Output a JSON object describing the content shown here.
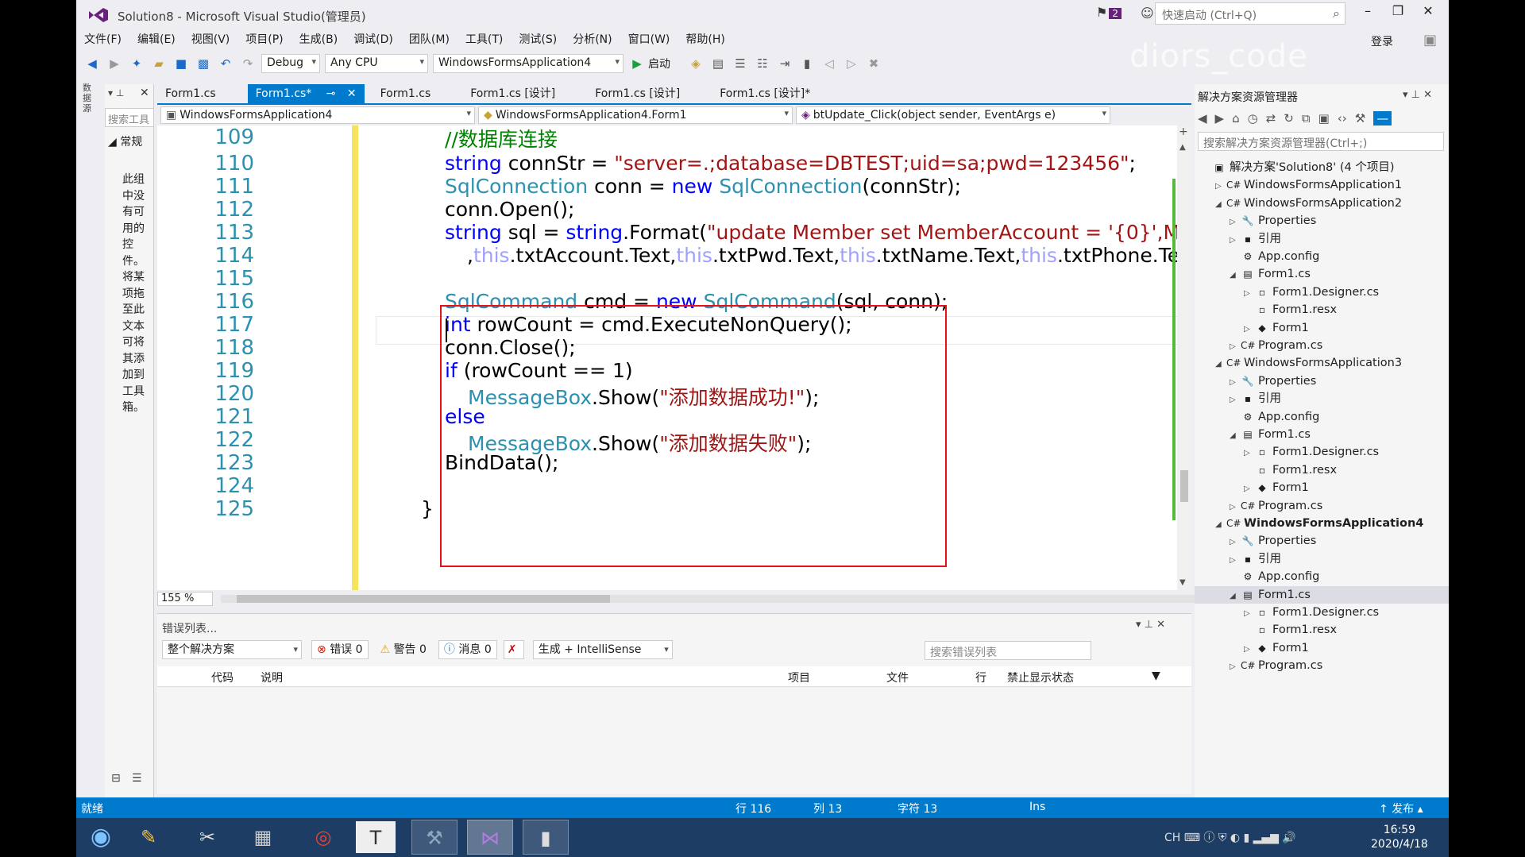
{
  "window": {
    "title": "Solution8 - Microsoft Visual Studio(管理员)",
    "notif_count": "2",
    "quick_launch_placeholder": "快速启动 (Ctrl+Q)",
    "login": "登录",
    "watermark": "diors_code"
  },
  "menu": [
    "文件(F)",
    "编辑(E)",
    "视图(V)",
    "项目(P)",
    "生成(B)",
    "调试(D)",
    "团队(M)",
    "工具(T)",
    "测试(S)",
    "分析(N)",
    "窗口(W)",
    "帮助(H)"
  ],
  "toolbar": {
    "config": "Debug",
    "platform": "Any CPU",
    "startup": "WindowsFormsApplication4",
    "start": "启动"
  },
  "toolbox": {
    "search": "搜索工具",
    "group": "常规",
    "hint": "此组中没有可用的控件。将某项拖至此文本可将其添加到工具箱。"
  },
  "tabs": [
    {
      "label": "Form1.cs",
      "active": false
    },
    {
      "label": "Form1.cs*",
      "active": true
    },
    {
      "label": "Form1.cs",
      "active": false
    },
    {
      "label": "Form1.cs [设计]",
      "active": false
    },
    {
      "label": "Form1.cs [设计]",
      "active": false
    },
    {
      "label": "Form1.cs [设计]*",
      "active": false
    }
  ],
  "nav": {
    "project": "WindowsFormsApplication4",
    "class": "WindowsFormsApplication4.Form1",
    "member": "btUpdate_Click(object sender, EventArgs e)"
  },
  "editor": {
    "zoom": "155 %",
    "line_numbers": [
      "109",
      "110",
      "111",
      "112",
      "113",
      "114",
      "115",
      "116",
      "117",
      "118",
      "119",
      "120",
      "121",
      "122",
      "123",
      "124",
      "125"
    ]
  },
  "error_list": {
    "title": "错误列表...",
    "scope": "整个解决方案",
    "errors": "错误 0",
    "warnings": "警告 0",
    "messages": "消息 0",
    "source": "生成 + IntelliSense",
    "search": "搜索错误列表",
    "columns": [
      "代码",
      "说明",
      "项目",
      "文件",
      "行",
      "禁止显示状态"
    ]
  },
  "solution_explorer": {
    "title": "解决方案资源管理器",
    "search": "搜索解决方案资源管理器(Ctrl+;)",
    "items": [
      {
        "label": "解决方案'Solution8' (4 个项目)",
        "level": 0,
        "exp": "",
        "icon": "▣"
      },
      {
        "label": "WindowsFormsApplication1",
        "level": 1,
        "exp": "▷",
        "icon": "C#"
      },
      {
        "label": "WindowsFormsApplication2",
        "level": 1,
        "exp": "◢",
        "icon": "C#"
      },
      {
        "label": "Properties",
        "level": 2,
        "exp": "▷",
        "icon": "🔧"
      },
      {
        "label": "引用",
        "level": 2,
        "exp": "▷",
        "icon": "▪"
      },
      {
        "label": "App.config",
        "level": 2,
        "exp": "",
        "icon": "⚙"
      },
      {
        "label": "Form1.cs",
        "level": 2,
        "exp": "◢",
        "icon": "▤"
      },
      {
        "label": "Form1.Designer.cs",
        "level": 3,
        "exp": "▷",
        "icon": "▫"
      },
      {
        "label": "Form1.resx",
        "level": 3,
        "exp": "",
        "icon": "▫"
      },
      {
        "label": "Form1",
        "level": 3,
        "exp": "▷",
        "icon": "◆"
      },
      {
        "label": "Program.cs",
        "level": 2,
        "exp": "▷",
        "icon": "C#"
      },
      {
        "label": "WindowsFormsApplication3",
        "level": 1,
        "exp": "◢",
        "icon": "C#"
      },
      {
        "label": "Properties",
        "level": 2,
        "exp": "▷",
        "icon": "🔧"
      },
      {
        "label": "引用",
        "level": 2,
        "exp": "▷",
        "icon": "▪"
      },
      {
        "label": "App.config",
        "level": 2,
        "exp": "",
        "icon": "⚙"
      },
      {
        "label": "Form1.cs",
        "level": 2,
        "exp": "◢",
        "icon": "▤"
      },
      {
        "label": "Form1.Designer.cs",
        "level": 3,
        "exp": "▷",
        "icon": "▫"
      },
      {
        "label": "Form1.resx",
        "level": 3,
        "exp": "",
        "icon": "▫"
      },
      {
        "label": "Form1",
        "level": 3,
        "exp": "▷",
        "icon": "◆"
      },
      {
        "label": "Program.cs",
        "level": 2,
        "exp": "▷",
        "icon": "C#"
      },
      {
        "label": "WindowsFormsApplication4",
        "level": 1,
        "exp": "◢",
        "icon": "C#",
        "bold": true
      },
      {
        "label": "Properties",
        "level": 2,
        "exp": "▷",
        "icon": "🔧"
      },
      {
        "label": "引用",
        "level": 2,
        "exp": "▷",
        "icon": "▪"
      },
      {
        "label": "App.config",
        "level": 2,
        "exp": "",
        "icon": "⚙"
      },
      {
        "label": "Form1.cs",
        "level": 2,
        "exp": "◢",
        "icon": "▤",
        "selected": true
      },
      {
        "label": "Form1.Designer.cs",
        "level": 3,
        "exp": "▷",
        "icon": "▫"
      },
      {
        "label": "Form1.resx",
        "level": 3,
        "exp": "",
        "icon": "▫"
      },
      {
        "label": "Form1",
        "level": 3,
        "exp": "▷",
        "icon": "◆"
      },
      {
        "label": "Program.cs",
        "level": 2,
        "exp": "▷",
        "icon": "C#"
      }
    ]
  },
  "status": {
    "ready": "就绪",
    "line": "行 116",
    "col": "列 13",
    "ch": "字符 13",
    "mode": "Ins",
    "publish": "发布"
  },
  "taskbar": {
    "time": "16:59",
    "date": "2020/4/18",
    "ime": "CH"
  },
  "colors": {
    "accent": "#007acc",
    "highlight_box": "#e8101c",
    "keyword": "#0000ff",
    "type": "#2b91af",
    "string": "#a31515",
    "comment": "#008000"
  }
}
